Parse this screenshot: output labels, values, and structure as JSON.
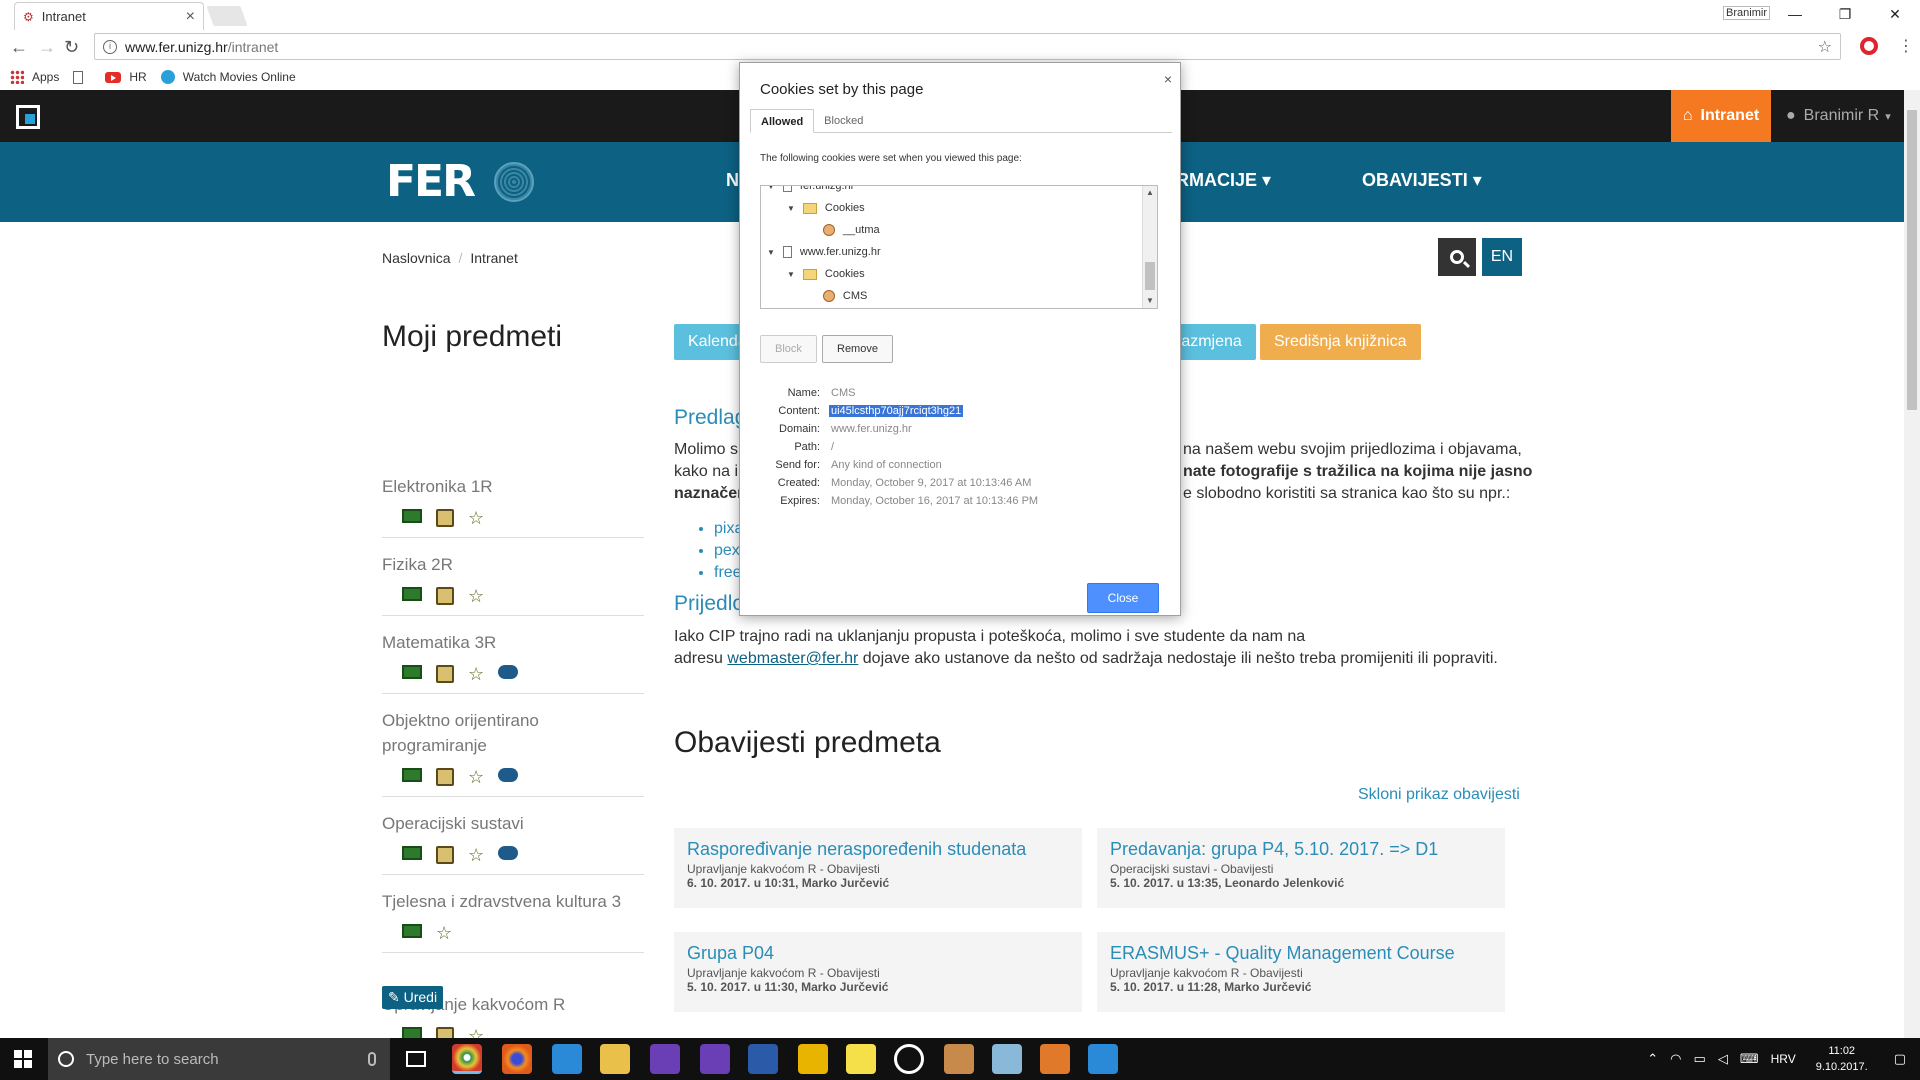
{
  "browser": {
    "tab_title": "Intranet",
    "tab_close": "×",
    "window_user": "Branimir",
    "window_buttons": [
      "—",
      "❐",
      "✕"
    ],
    "url_host": "www.fer.unizg.hr",
    "url_path": "/intranet",
    "bookmarks": [
      {
        "label": "Apps"
      },
      {
        "label": ""
      },
      {
        "label": "HR"
      },
      {
        "label": "Watch Movies Online"
      }
    ]
  },
  "site": {
    "intranet_label": "Intranet",
    "user_label": "Branimir R",
    "logo_text": "FER",
    "nav": [
      "N",
      "RMACIJE ▾",
      "OBAVIJESTI ▾"
    ],
    "breadcrumb": [
      "Naslovnica",
      "Intranet"
    ],
    "lang_button": "EN"
  },
  "sidebar": {
    "title": "Moji predmeti",
    "courses": [
      {
        "name": "Elektronika 1R",
        "chat": false,
        "copy": true
      },
      {
        "name": "Fizika 2R",
        "chat": false,
        "copy": true
      },
      {
        "name": "Matematika 3R",
        "chat": true,
        "copy": true
      },
      {
        "name": "Objektno orijentirano programiranje",
        "chat": true,
        "copy": true
      },
      {
        "name": "Operacijski sustavi",
        "chat": true,
        "copy": true
      },
      {
        "name": "Tjelesna i zdravstvena kultura 3",
        "chat": false,
        "copy": false
      },
      {
        "name": "Upravljanje kakvoćom R",
        "chat": false,
        "copy": true
      }
    ],
    "edit_button": "✎ Uredi"
  },
  "main": {
    "pills": [
      "Kalenda",
      "razmjena",
      "Središnja knjižnica"
    ],
    "heading1": "Predlag",
    "para1_line1_a": "Molimo s",
    "para1_line1_b": "na našem webu svojim prijedlozima i objavama,",
    "para1_line2_a": "kako na i",
    "para1_line2_b": "nate fotografije s tražilica na kojima nije jasno",
    "para1_line3_a": "naznačen",
    "para1_line3_b": "e slobodno koristiti sa stranica kao što su npr.:",
    "bullets": [
      "pixa",
      "pex",
      "free"
    ],
    "heading2": "Prijedlo",
    "para2_line1": "Iako CIP trajno radi na uklanjanju propusta i poteškoća, molimo i sve studente da nam na",
    "para2_line2_a": "adresu ",
    "para2_email": "webmaster@fer.hr",
    "para2_line2_b": " dojave ako ustanove da nešto od sadržaja nedostaje ili nešto treba promijeniti ili popraviti.",
    "obav_title": "Obavijesti predmeta",
    "hide_link": "Skloni prikaz obavijesti",
    "cards": [
      {
        "title": "Raspoređivanje neraspoređenih studenata",
        "sub": "Upravljanje kakvoćom R - Obavijesti",
        "meta": "6. 10. 2017. u 10:31, Marko Jurčević"
      },
      {
        "title": "Predavanja: grupa P4, 5.10. 2017. => D1",
        "sub": "Operacijski sustavi - Obavijesti",
        "meta": "5. 10. 2017. u 13:35, Leonardo Jelenković"
      },
      {
        "title": "Grupa P04",
        "sub": "Upravljanje kakvoćom R - Obavijesti",
        "meta": "5. 10. 2017. u 11:30, Marko Jurčević"
      },
      {
        "title": "ERASMUS+ - Quality Management Course",
        "sub": "Upravljanje kakvoćom R - Obavijesti",
        "meta": "5. 10. 2017. u 11:28, Marko Jurčević"
      }
    ]
  },
  "dialog": {
    "title": "Cookies set by this page",
    "close_x": "×",
    "tabs": [
      "Allowed",
      "Blocked"
    ],
    "intro": "The following cookies were set when you viewed this page:",
    "tree": [
      {
        "label": "fer.unizg.hr",
        "type": "doc",
        "indent": 0,
        "twisty": "▼"
      },
      {
        "label": "Cookies",
        "type": "folder",
        "indent": 1,
        "twisty": "▼"
      },
      {
        "label": "__utma",
        "type": "cookie",
        "indent": 2,
        "twisty": ""
      },
      {
        "label": "www.fer.unizg.hr",
        "type": "doc",
        "indent": 0,
        "twisty": "▼"
      },
      {
        "label": "Cookies",
        "type": "folder",
        "indent": 1,
        "twisty": "▼"
      },
      {
        "label": "CMS",
        "type": "cookie",
        "indent": 2,
        "twisty": ""
      }
    ],
    "block_button": "Block",
    "remove_button": "Remove",
    "details": [
      {
        "label": "Name:",
        "value": "CMS",
        "selected": false
      },
      {
        "label": "Content:",
        "value": "ui45lcsthp70ajj7rciqt3hg21",
        "selected": true
      },
      {
        "label": "Domain:",
        "value": "www.fer.unizg.hr",
        "selected": false
      },
      {
        "label": "Path:",
        "value": "/",
        "selected": false
      },
      {
        "label": "Send for:",
        "value": "Any kind of connection",
        "selected": false
      },
      {
        "label": "Created:",
        "value": "Monday, October 9, 2017 at 10:13:46 AM",
        "selected": false
      },
      {
        "label": "Expires:",
        "value": "Monday, October 16, 2017 at 10:13:46 PM",
        "selected": false
      }
    ],
    "close_button": "Close"
  },
  "taskbar": {
    "search_placeholder": "Type here to search",
    "language": "HRV",
    "time": "11:02",
    "date": "9.10.2017."
  }
}
